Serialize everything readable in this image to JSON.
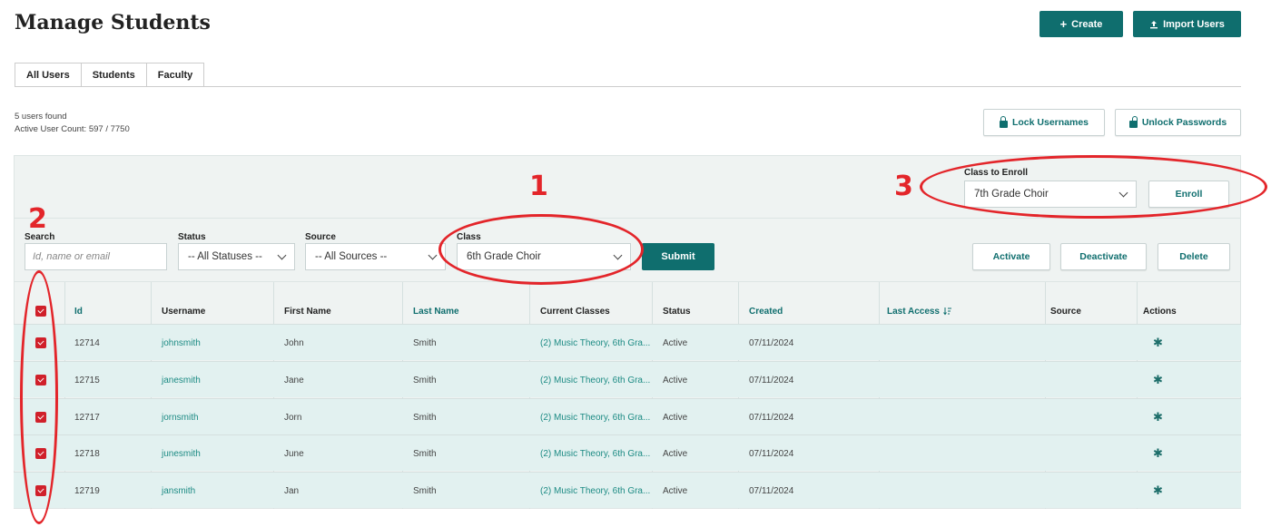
{
  "page": {
    "title": "Manage Students"
  },
  "header_actions": {
    "create_icon": "plus-icon",
    "create_label": "Create",
    "import_icon": "upload-icon",
    "import_label": "Import Users"
  },
  "tabs": [
    {
      "label": "All Users",
      "active": false
    },
    {
      "label": "Students",
      "active": true
    },
    {
      "label": "Faculty",
      "active": false
    }
  ],
  "summary": {
    "users_found": "5 users found",
    "active_count": "Active User Count: 597 / 7750"
  },
  "lock_actions": {
    "lock_icon": "lock-icon",
    "lock_label": "Lock Usernames",
    "unlock_icon": "unlock-icon",
    "unlock_label": "Unlock Passwords"
  },
  "enroll": {
    "label": "Class to Enroll",
    "selected": "7th Grade Choir",
    "button": "Enroll"
  },
  "filters": {
    "search_label": "Search",
    "search_placeholder": "Id, name or email",
    "status_label": "Status",
    "status_selected": "-- All Statuses --",
    "source_label": "Source",
    "source_selected": "-- All Sources --",
    "class_label": "Class",
    "class_selected": "6th Grade Choir",
    "submit": "Submit"
  },
  "bulk_actions": {
    "activate": "Activate",
    "deactivate": "Deactivate",
    "delete": "Delete"
  },
  "table": {
    "columns": {
      "id": "Id",
      "username": "Username",
      "first_name": "First Name",
      "last_name": "Last Name",
      "current_classes": "Current Classes",
      "status": "Status",
      "created": "Created",
      "last_access": "Last Access",
      "source": "Source",
      "actions": "Actions"
    },
    "last_access_sort_icon": "sort-descending-icon",
    "row_action_icon": "gear-icon",
    "rows": [
      {
        "id": "12714",
        "username": "johnsmith",
        "first_name": "John",
        "last_name": "Smith",
        "classes": "(2) Music Theory, 6th Gra...",
        "status": "Active",
        "created": "07/11/2024",
        "last_access": "",
        "source": "",
        "checked": true
      },
      {
        "id": "12715",
        "username": "janesmith",
        "first_name": "Jane",
        "last_name": "Smith",
        "classes": "(2) Music Theory, 6th Gra...",
        "status": "Active",
        "created": "07/11/2024",
        "last_access": "",
        "source": "",
        "checked": true
      },
      {
        "id": "12717",
        "username": "jornsmith",
        "first_name": "Jorn",
        "last_name": "Smith",
        "classes": "(2) Music Theory, 6th Gra...",
        "status": "Active",
        "created": "07/11/2024",
        "last_access": "",
        "source": "",
        "checked": true
      },
      {
        "id": "12718",
        "username": "junesmith",
        "first_name": "June",
        "last_name": "Smith",
        "classes": "(2) Music Theory, 6th Gra...",
        "status": "Active",
        "created": "07/11/2024",
        "last_access": "",
        "source": "",
        "checked": true
      },
      {
        "id": "12719",
        "username": "jansmith",
        "first_name": "Jan",
        "last_name": "Smith",
        "classes": "(2) Music Theory, 6th Gra...",
        "status": "Active",
        "created": "07/11/2024",
        "last_access": "",
        "source": "",
        "checked": true
      }
    ]
  },
  "annotations": {
    "one": "1",
    "two": "2",
    "three": "3",
    "color": "#e3252a"
  },
  "colors": {
    "primary": "#0f6e6e",
    "link": "#1d8b84",
    "row_bg": "#e2f1f0",
    "panel_bg": "#eff3f2",
    "checkbox": "#d0202a"
  }
}
